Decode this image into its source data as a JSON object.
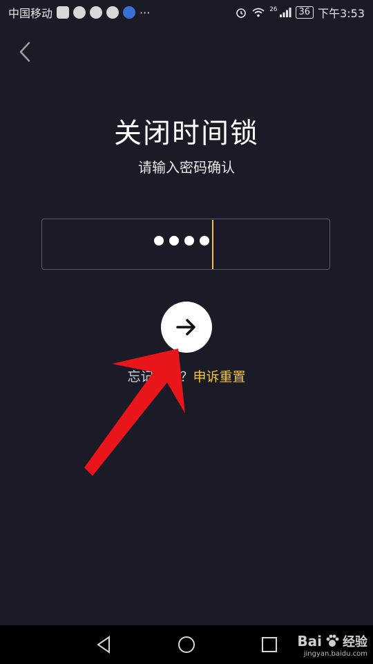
{
  "status_bar": {
    "carrier": "中国移动",
    "more": "···",
    "network": "26",
    "battery": "36",
    "time": "下午3:53"
  },
  "page": {
    "title": "关闭时间锁",
    "subtitle": "请输入密码确认"
  },
  "password_input": {
    "masked_length": 4,
    "cursor_color": "#f2c531"
  },
  "forgot": {
    "prefix": "忘记密码？",
    "link": "申诉重置"
  },
  "colors": {
    "background": "#1a1b26",
    "accent": "#f2c531",
    "arrow_annotation": "#e8151b"
  },
  "watermark": {
    "brand": "Bai",
    "brand_cn": "经验",
    "url": "jingyan.baidu.com"
  }
}
